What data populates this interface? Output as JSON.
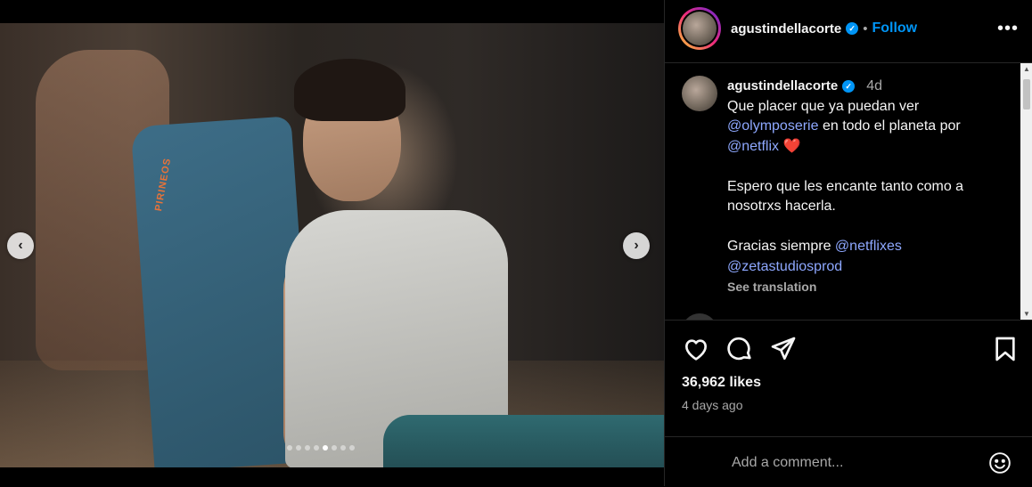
{
  "post": {
    "username": "agustindellacorte",
    "follow_label": "Follow",
    "separator": "•",
    "more_label": "•••"
  },
  "media": {
    "towel_text": "PIRINEOS",
    "nav_prev": "‹",
    "nav_next": "›",
    "slide_count": 8,
    "active_slide": 5
  },
  "caption": {
    "time": "4d",
    "line1": "Que placer que ya puedan ver",
    "mention1": "@olymposerie",
    "line2": " en todo el planeta por",
    "mention2": "@netflix",
    "heart": " ❤️",
    "para2": "Espero que les encante tanto como a nosotrxs hacerla.",
    "para3_text": "Gracias siempre ",
    "mention3": "@netflixes",
    "mention4": "@zetastudiosprod",
    "see_translation": "See translation"
  },
  "stats": {
    "likes": "36,962 likes",
    "date": "4 days ago"
  },
  "comment_box": {
    "placeholder": "Add a comment..."
  },
  "colors": {
    "accent": "#0095f6",
    "mention": "#8ea8ff",
    "muted": "#a8a8a8"
  }
}
